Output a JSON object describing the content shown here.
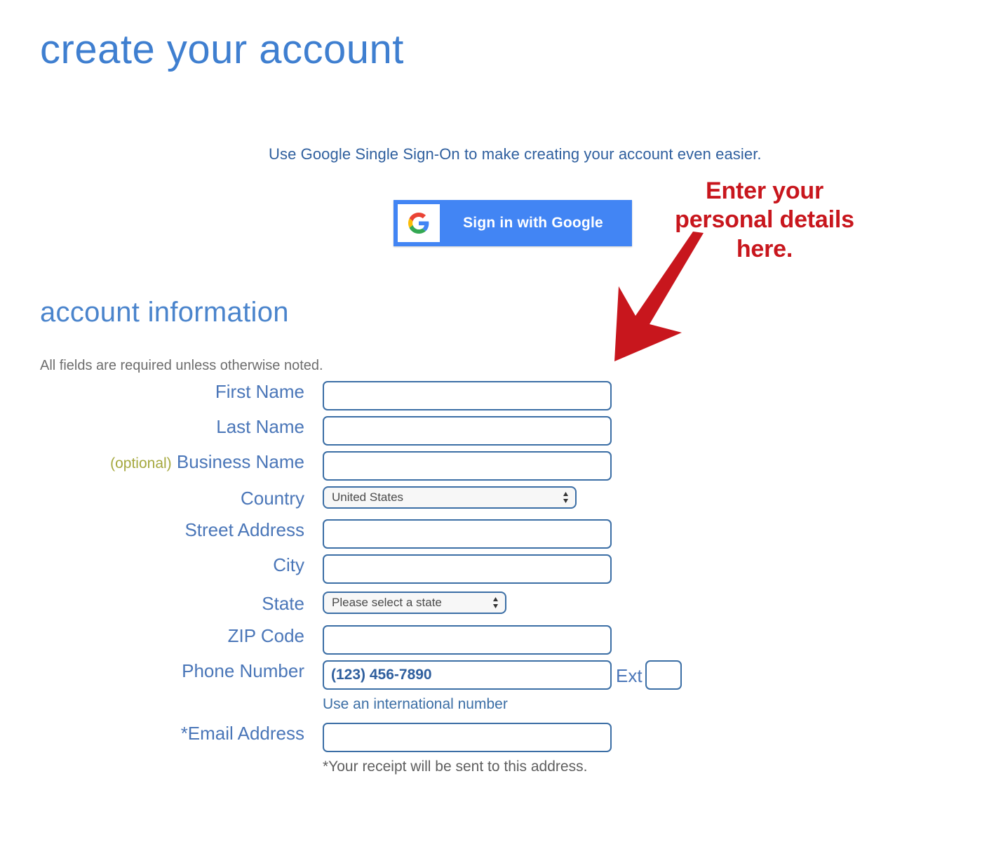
{
  "page": {
    "title": "create your account"
  },
  "sso": {
    "description": "Use Google Single Sign-On to make creating your account even easier.",
    "button_label": "Sign in with Google",
    "icon": "google-g-icon",
    "button_color": "#4285f4"
  },
  "annotation": {
    "text": "Enter your personal details here.",
    "color": "#c8161d",
    "arrow": "arrow-down-left"
  },
  "section": {
    "title": "account information",
    "note": "All fields are required unless otherwise noted."
  },
  "form": {
    "fields": [
      {
        "id": "first-name",
        "label": "First Name",
        "optional_tag": "",
        "type": "text",
        "value": "",
        "placeholder": ""
      },
      {
        "id": "last-name",
        "label": "Last Name",
        "optional_tag": "",
        "type": "text",
        "value": "",
        "placeholder": ""
      },
      {
        "id": "business-name",
        "label": "Business Name",
        "optional_tag": "(optional)",
        "type": "text",
        "value": "",
        "placeholder": ""
      },
      {
        "id": "country",
        "label": "Country",
        "optional_tag": "",
        "type": "select",
        "value": "United States",
        "placeholder": ""
      },
      {
        "id": "street-address",
        "label": "Street Address",
        "optional_tag": "",
        "type": "text",
        "value": "",
        "placeholder": ""
      },
      {
        "id": "city",
        "label": "City",
        "optional_tag": "",
        "type": "text",
        "value": "",
        "placeholder": ""
      },
      {
        "id": "state",
        "label": "State",
        "optional_tag": "",
        "type": "select",
        "value": "Please select a state",
        "placeholder": ""
      },
      {
        "id": "zip-code",
        "label": "ZIP Code",
        "optional_tag": "",
        "type": "text",
        "value": "",
        "placeholder": ""
      },
      {
        "id": "phone-number",
        "label": "Phone Number",
        "optional_tag": "",
        "type": "text",
        "value": "",
        "placeholder": "(123) 456-7890"
      },
      {
        "id": "email-address",
        "label": "*Email Address",
        "optional_tag": "",
        "type": "text",
        "value": "",
        "placeholder": ""
      }
    ],
    "ext_label": "Ext",
    "ext_value": "",
    "phone_helper": "Use an international number",
    "email_footnote": "*Your receipt will be sent to this address."
  },
  "colors": {
    "title_blue": "#3f7fd0",
    "label_blue": "#4a76b8",
    "border_blue": "#3b6ea5",
    "optional_olive": "#a5a83e",
    "annotation_red": "#c8161d"
  }
}
